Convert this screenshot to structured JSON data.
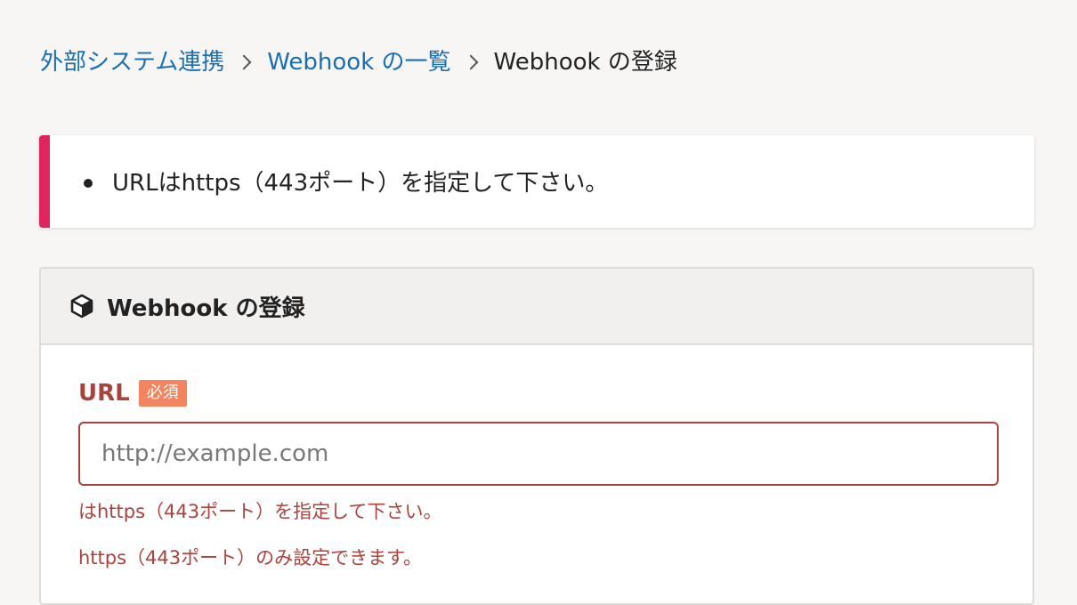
{
  "breadcrumb": {
    "items": [
      {
        "label": "外部システム連携",
        "link": true
      },
      {
        "label": "Webhook の一覧",
        "link": true
      },
      {
        "label": "Webhook の登録",
        "link": false
      }
    ]
  },
  "alert": {
    "messages": [
      "URLはhttps（443ポート）を指定して下さい。"
    ],
    "accent_color": "#e0245e"
  },
  "panel": {
    "title": "Webhook の登録",
    "icon": "cube-icon"
  },
  "form": {
    "url": {
      "label": "URL",
      "required_badge": "必須",
      "value": "",
      "placeholder": "http://example.com",
      "errors": [
        "はhttps（443ポート）を指定して下さい。",
        "https（443ポート）のみ設定できます。"
      ]
    }
  },
  "colors": {
    "link": "#1a6fb0",
    "error": "#a8433d",
    "badge": "#f4845f"
  }
}
